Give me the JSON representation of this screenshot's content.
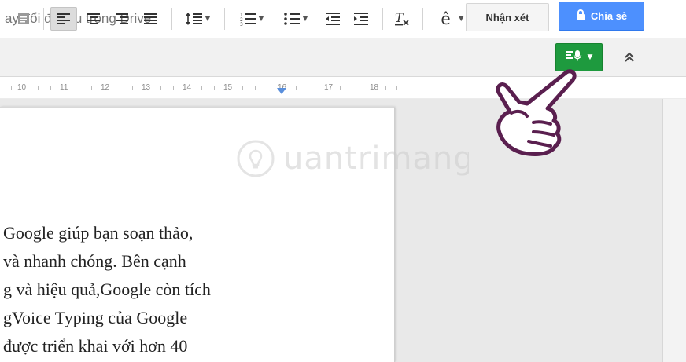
{
  "header": {
    "save_status": "ay đổi đã lưu trong Drive",
    "comments_label": "Nhận xét",
    "share_label": "Chia sẻ"
  },
  "toolbar": {
    "items": [
      {
        "name": "page-icon"
      },
      {
        "name": "align-left-icon",
        "selected": true
      },
      {
        "name": "align-center-icon"
      },
      {
        "name": "align-right-icon"
      },
      {
        "name": "align-justify-icon"
      },
      {
        "name": "line-spacing-icon"
      },
      {
        "name": "numbered-list-icon"
      },
      {
        "name": "bulleted-list-icon"
      },
      {
        "name": "decrease-indent-icon"
      },
      {
        "name": "increase-indent-icon"
      },
      {
        "name": "clear-formatting-icon"
      },
      {
        "name": "input-tools-icon"
      },
      {
        "name": "voice-typing-icon"
      },
      {
        "name": "collapse-icon"
      }
    ],
    "input_tools_glyph": "ê",
    "collapse_glyph": "⌃",
    "voice_typing_color": "#1e9a3e"
  },
  "ruler": {
    "numbers": [
      "10",
      "11",
      "12",
      "13",
      "14",
      "15",
      "16",
      "17",
      "18"
    ]
  },
  "document": {
    "lines": [
      "Google giúp bạn soạn thảo,",
      " và nhanh chóng. Bên cạnh",
      "g và hiệu quả,Google còn tích",
      "gVoice Typing của Google",
      " được triển khai với hơn 40"
    ]
  },
  "colors": {
    "share_blue": "#4d90fe",
    "voice_green": "#1e9a3e",
    "hand_outline": "#5a1f4f"
  }
}
